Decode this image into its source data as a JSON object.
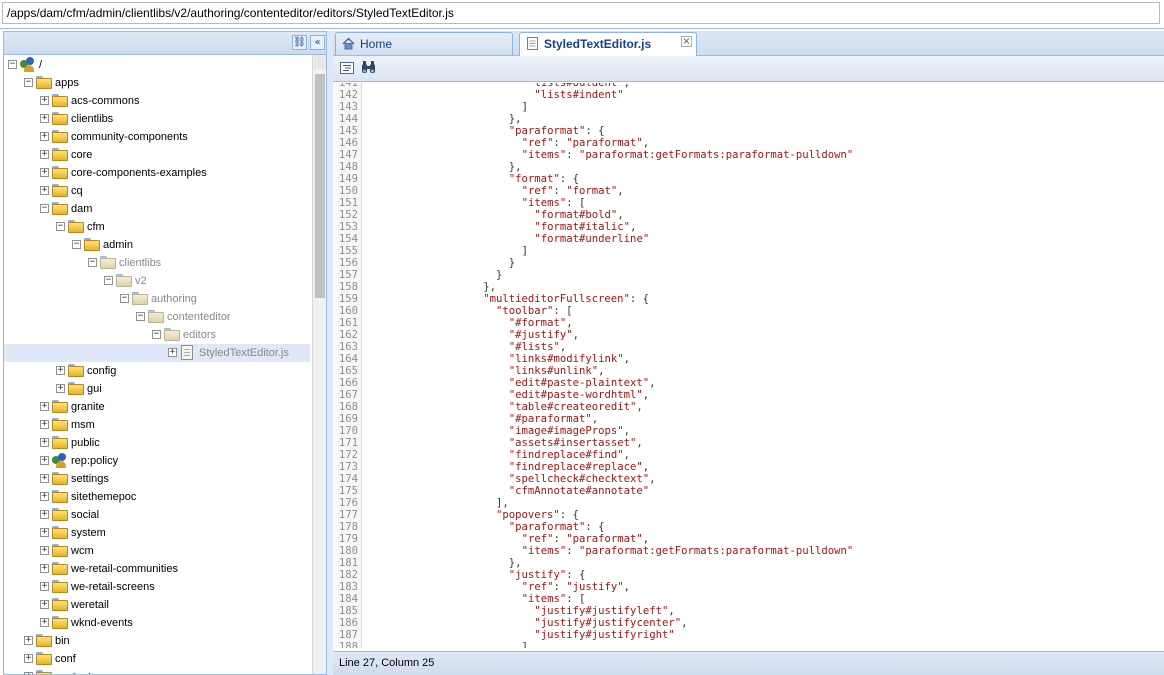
{
  "path_bar": {
    "value": "/apps/dam/cfm/admin/clientlibs/v2/authoring/contenteditor/editors/StyledTextEditor.js"
  },
  "left_panel": {
    "header_buttons": {
      "search": "⛓",
      "collapse": "«"
    },
    "tree": [
      {
        "label": "/",
        "depth": 0,
        "toggle": "−",
        "icon": "root"
      },
      {
        "label": "apps",
        "depth": 1,
        "toggle": "−",
        "icon": "folder"
      },
      {
        "label": "acs-commons",
        "depth": 2,
        "toggle": "+",
        "icon": "folder"
      },
      {
        "label": "clientlibs",
        "depth": 2,
        "toggle": "+",
        "icon": "folder"
      },
      {
        "label": "community-components",
        "depth": 2,
        "toggle": "+",
        "icon": "folder"
      },
      {
        "label": "core",
        "depth": 2,
        "toggle": "+",
        "icon": "folder"
      },
      {
        "label": "core-components-examples",
        "depth": 2,
        "toggle": "+",
        "icon": "folder"
      },
      {
        "label": "cq",
        "depth": 2,
        "toggle": "+",
        "icon": "folder"
      },
      {
        "label": "dam",
        "depth": 2,
        "toggle": "−",
        "icon": "folder"
      },
      {
        "label": "cfm",
        "depth": 3,
        "toggle": "−",
        "icon": "folder"
      },
      {
        "label": "admin",
        "depth": 4,
        "toggle": "−",
        "icon": "folder"
      },
      {
        "label": "clientlibs",
        "depth": 5,
        "toggle": "−",
        "icon": "folder-grey"
      },
      {
        "label": "v2",
        "depth": 6,
        "toggle": "−",
        "icon": "folder-grey"
      },
      {
        "label": "authoring",
        "depth": 7,
        "toggle": "−",
        "icon": "folder-grey"
      },
      {
        "label": "contenteditor",
        "depth": 8,
        "toggle": "−",
        "icon": "folder-grey"
      },
      {
        "label": "editors",
        "depth": 9,
        "toggle": "−",
        "icon": "folder-grey"
      },
      {
        "label": "StyledTextEditor.js",
        "depth": 10,
        "toggle": "+",
        "icon": "file",
        "selected": true
      },
      {
        "label": "config",
        "depth": 3,
        "toggle": "+",
        "icon": "folder"
      },
      {
        "label": "gui",
        "depth": 3,
        "toggle": "+",
        "icon": "folder"
      },
      {
        "label": "granite",
        "depth": 2,
        "toggle": "+",
        "icon": "folder"
      },
      {
        "label": "msm",
        "depth": 2,
        "toggle": "+",
        "icon": "folder"
      },
      {
        "label": "public",
        "depth": 2,
        "toggle": "+",
        "icon": "folder"
      },
      {
        "label": "rep:policy",
        "depth": 2,
        "toggle": "+",
        "icon": "policy"
      },
      {
        "label": "settings",
        "depth": 2,
        "toggle": "+",
        "icon": "folder"
      },
      {
        "label": "sitethemepoc",
        "depth": 2,
        "toggle": "+",
        "icon": "folder"
      },
      {
        "label": "social",
        "depth": 2,
        "toggle": "+",
        "icon": "folder"
      },
      {
        "label": "system",
        "depth": 2,
        "toggle": "+",
        "icon": "folder"
      },
      {
        "label": "wcm",
        "depth": 2,
        "toggle": "+",
        "icon": "folder"
      },
      {
        "label": "we-retail-communities",
        "depth": 2,
        "toggle": "+",
        "icon": "folder"
      },
      {
        "label": "we-retail-screens",
        "depth": 2,
        "toggle": "+",
        "icon": "folder"
      },
      {
        "label": "weretail",
        "depth": 2,
        "toggle": "+",
        "icon": "folder"
      },
      {
        "label": "wknd-events",
        "depth": 2,
        "toggle": "+",
        "icon": "folder"
      },
      {
        "label": "bin",
        "depth": 1,
        "toggle": "+",
        "icon": "folder"
      },
      {
        "label": "conf",
        "depth": 1,
        "toggle": "+",
        "icon": "folder"
      },
      {
        "label": "content",
        "depth": 1,
        "toggle": "+",
        "icon": "folder"
      }
    ]
  },
  "tabs": [
    {
      "label": "Home",
      "icon": "home-icon",
      "active": false
    },
    {
      "label": "StyledTextEditor.js",
      "icon": "file-icon",
      "active": true,
      "close": "×"
    }
  ],
  "toolbar": {
    "buttons": [
      "format-icon",
      "find-icon"
    ]
  },
  "editor": {
    "lines": [
      {
        "n": "141",
        "indent": 25,
        "text": "\"lists#outdent\","
      },
      {
        "n": "142",
        "indent": 26,
        "text": "\"lists#indent\""
      },
      {
        "n": "143",
        "indent": 24,
        "text": "]"
      },
      {
        "n": "144",
        "indent": 22,
        "text": "},"
      },
      {
        "n": "145",
        "indent": 22,
        "text": "\"paraformat\": {"
      },
      {
        "n": "146",
        "indent": 24,
        "text": "\"ref\": \"paraformat\","
      },
      {
        "n": "147",
        "indent": 24,
        "text": "\"items\": \"paraformat:getFormats:paraformat-pulldown\""
      },
      {
        "n": "148",
        "indent": 22,
        "text": "},"
      },
      {
        "n": "149",
        "indent": 22,
        "text": "\"format\": {"
      },
      {
        "n": "150",
        "indent": 24,
        "text": "\"ref\": \"format\","
      },
      {
        "n": "151",
        "indent": 24,
        "text": "\"items\": ["
      },
      {
        "n": "152",
        "indent": 26,
        "text": "\"format#bold\","
      },
      {
        "n": "153",
        "indent": 26,
        "text": "\"format#italic\","
      },
      {
        "n": "154",
        "indent": 26,
        "text": "\"format#underline\""
      },
      {
        "n": "155",
        "indent": 24,
        "text": "]"
      },
      {
        "n": "156",
        "indent": 22,
        "text": "}"
      },
      {
        "n": "157",
        "indent": 20,
        "text": "}"
      },
      {
        "n": "158",
        "indent": 18,
        "text": "},"
      },
      {
        "n": "159",
        "indent": 18,
        "text": "\"multieditorFullscreen\": {"
      },
      {
        "n": "160",
        "indent": 20,
        "text": "\"toolbar\": ["
      },
      {
        "n": "161",
        "indent": 22,
        "text": "\"#format\","
      },
      {
        "n": "162",
        "indent": 22,
        "text": "\"#justify\","
      },
      {
        "n": "163",
        "indent": 22,
        "text": "\"#lists\","
      },
      {
        "n": "164",
        "indent": 22,
        "text": "\"links#modifylink\","
      },
      {
        "n": "165",
        "indent": 22,
        "text": "\"links#unlink\","
      },
      {
        "n": "166",
        "indent": 22,
        "text": "\"edit#paste-plaintext\","
      },
      {
        "n": "167",
        "indent": 22,
        "text": "\"edit#paste-wordhtml\","
      },
      {
        "n": "168",
        "indent": 22,
        "text": "\"table#createoredit\","
      },
      {
        "n": "169",
        "indent": 22,
        "text": "\"#paraformat\","
      },
      {
        "n": "170",
        "indent": 22,
        "text": "\"image#imageProps\","
      },
      {
        "n": "171",
        "indent": 22,
        "text": "\"assets#insertasset\","
      },
      {
        "n": "172",
        "indent": 22,
        "text": "\"findreplace#find\","
      },
      {
        "n": "173",
        "indent": 22,
        "text": "\"findreplace#replace\","
      },
      {
        "n": "174",
        "indent": 22,
        "text": "\"spellcheck#checktext\","
      },
      {
        "n": "175",
        "indent": 22,
        "text": "\"cfmAnnotate#annotate\""
      },
      {
        "n": "176",
        "indent": 20,
        "text": "],"
      },
      {
        "n": "177",
        "indent": 20,
        "text": "\"popovers\": {"
      },
      {
        "n": "178",
        "indent": 22,
        "text": "\"paraformat\": {"
      },
      {
        "n": "179",
        "indent": 24,
        "text": "\"ref\": \"paraformat\","
      },
      {
        "n": "180",
        "indent": 24,
        "text": "\"items\": \"paraformat:getFormats:paraformat-pulldown\""
      },
      {
        "n": "181",
        "indent": 22,
        "text": "},"
      },
      {
        "n": "182",
        "indent": 22,
        "text": "\"justify\": {"
      },
      {
        "n": "183",
        "indent": 24,
        "text": "\"ref\": \"justify\","
      },
      {
        "n": "184",
        "indent": 24,
        "text": "\"items\": ["
      },
      {
        "n": "185",
        "indent": 26,
        "text": "\"justify#justifyleft\","
      },
      {
        "n": "186",
        "indent": 26,
        "text": "\"justify#justifycenter\","
      },
      {
        "n": "187",
        "indent": 26,
        "text": "\"justify#justifyright\""
      },
      {
        "n": "188",
        "indent": 24,
        "text": "]"
      }
    ]
  },
  "status": {
    "text": "Line 27, Column 25"
  }
}
